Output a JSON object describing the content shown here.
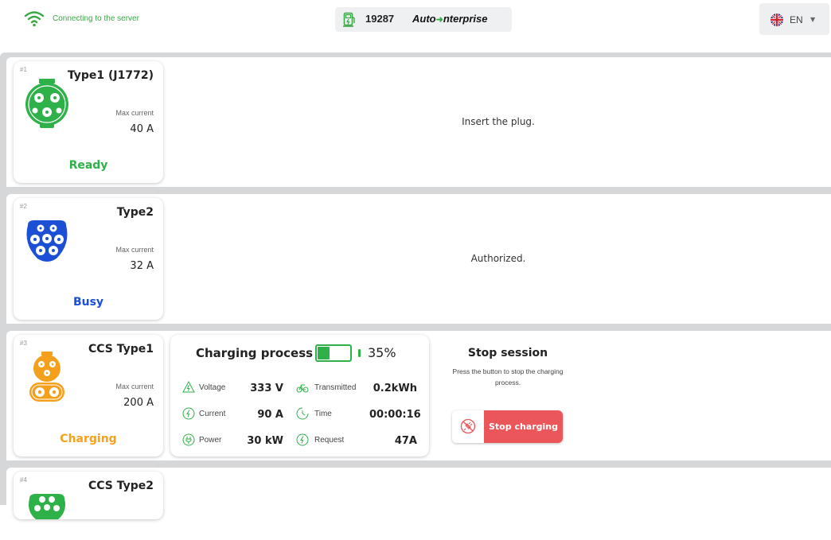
{
  "header": {
    "connection_text": "Connecting to the server",
    "station_id": "19287",
    "brand_left": "Auto",
    "brand_right": "nterprise",
    "language": "EN"
  },
  "connectors": [
    {
      "number": "#1",
      "type": "Type1 (J1772)",
      "max_current_label": "Max current",
      "max_current": "40 A",
      "status": "Ready",
      "status_color": "#2fb14a",
      "plug_color": "#2fb14a",
      "message": "Insert the plug."
    },
    {
      "number": "#2",
      "type": "Type2",
      "max_current_label": "Max current",
      "max_current": "32 A",
      "status": "Busy",
      "status_color": "#1a4fd6",
      "plug_color": "#1a4fd6",
      "message": "Authorized."
    },
    {
      "number": "#3",
      "type": "CCS Type1",
      "max_current_label": "Max current",
      "max_current": "200 A",
      "status": "Charging",
      "status_color": "#f4a01c",
      "plug_color": "#f4a01c",
      "charging": {
        "title": "Charging process",
        "battery_percent": "35%",
        "battery_level": 0.35,
        "metrics": {
          "voltage_label": "Voltage",
          "voltage": "333 V",
          "current_label": "Current",
          "current": "90 A",
          "power_label": "Power",
          "power": "30 kW",
          "transmitted_label": "Transmitted",
          "transmitted": "0.2kWh",
          "time_label": "Time",
          "time": "00:00:16",
          "request_label": "Request",
          "request": "47A"
        }
      },
      "stop": {
        "title": "Stop session",
        "description": "Press the button to stop the charging process.",
        "button_label": "Stop charging"
      }
    },
    {
      "number": "#4",
      "type": "CCS Type2",
      "plug_color": "#2fb14a"
    }
  ]
}
